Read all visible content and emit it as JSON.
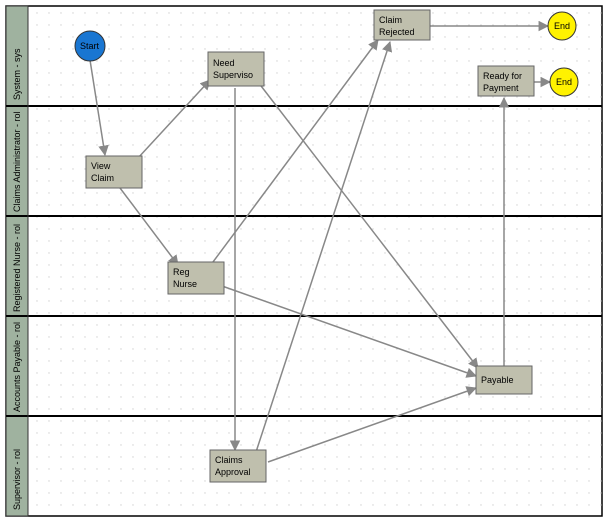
{
  "diagram": {
    "lanes": [
      {
        "id": "system",
        "label": "System - sys"
      },
      {
        "id": "claimsadmin",
        "label": "Claims Administrator - rol"
      },
      {
        "id": "regnurse",
        "label": "Registered Nurse - rol"
      },
      {
        "id": "ap",
        "label": "Accounts Payable - rol"
      },
      {
        "id": "supervisor",
        "label": "Supervisor - rol"
      }
    ],
    "nodes": {
      "start": {
        "label": "Start"
      },
      "need_superviso": {
        "label_l1": "Need",
        "label_l2": "Superviso"
      },
      "claim_rejected": {
        "label_l1": "Claim",
        "label_l2": "Rejected"
      },
      "ready_payment": {
        "label_l1": "Ready for",
        "label_l2": "Payment"
      },
      "end1": {
        "label": "End"
      },
      "end2": {
        "label": "End"
      },
      "view_claim": {
        "label_l1": "View",
        "label_l2": "Claim"
      },
      "reg_nurse": {
        "label_l1": "Reg",
        "label_l2": "Nurse"
      },
      "payable": {
        "label": "Payable"
      },
      "claims_approval": {
        "label_l1": "Claims",
        "label_l2": "Approval"
      }
    },
    "chart_data": {
      "type": "table",
      "swimlanes": [
        "System - sys",
        "Claims Administrator - rol",
        "Registered Nurse - rol",
        "Accounts Payable - rol",
        "Supervisor - rol"
      ],
      "steps": [
        {
          "name": "Start",
          "lane": "System - sys",
          "kind": "start"
        },
        {
          "name": "Need Superviso",
          "lane": "System - sys",
          "kind": "task"
        },
        {
          "name": "Claim Rejected",
          "lane": "System - sys",
          "kind": "task"
        },
        {
          "name": "Ready for Payment",
          "lane": "System - sys",
          "kind": "task"
        },
        {
          "name": "End",
          "lane": "System - sys",
          "kind": "end"
        },
        {
          "name": "End",
          "lane": "System - sys",
          "kind": "end"
        },
        {
          "name": "View Claim",
          "lane": "Claims Administrator - rol",
          "kind": "task"
        },
        {
          "name": "Reg Nurse",
          "lane": "Registered Nurse - rol",
          "kind": "task"
        },
        {
          "name": "Payable",
          "lane": "Accounts Payable - rol",
          "kind": "task"
        },
        {
          "name": "Claims Approval",
          "lane": "Supervisor - rol",
          "kind": "task"
        }
      ],
      "edges": [
        [
          "Start",
          "View Claim"
        ],
        [
          "View Claim",
          "Need Superviso"
        ],
        [
          "View Claim",
          "Reg Nurse"
        ],
        [
          "Need Superviso",
          "Claims Approval"
        ],
        [
          "Need Superviso",
          "Payable"
        ],
        [
          "Reg Nurse",
          "Claim Rejected"
        ],
        [
          "Reg Nurse",
          "Payable"
        ],
        [
          "Claims Approval",
          "Claim Rejected"
        ],
        [
          "Claims Approval",
          "Payable"
        ],
        [
          "Payable",
          "Ready for Payment"
        ],
        [
          "Claim Rejected",
          "End"
        ],
        [
          "Ready for Payment",
          "End"
        ]
      ]
    }
  }
}
